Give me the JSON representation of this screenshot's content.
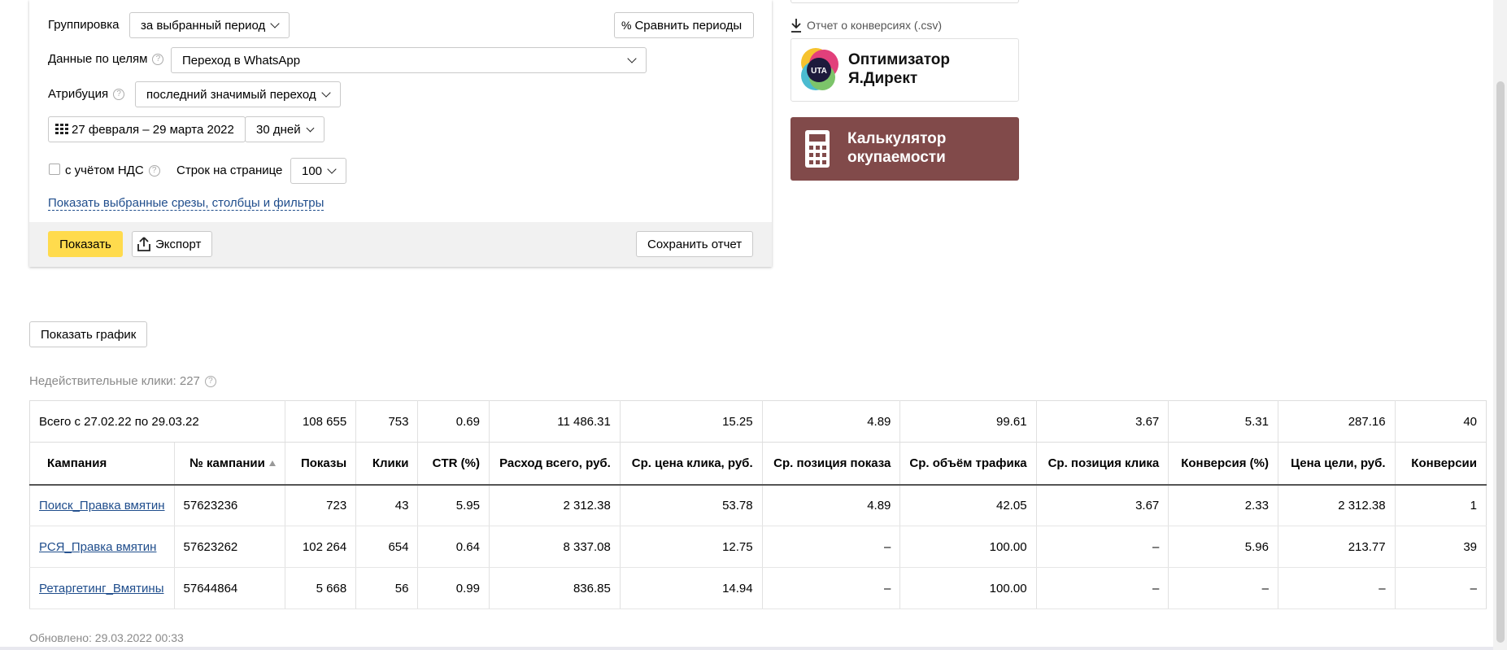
{
  "filters": {
    "grouping_label": "Группировка",
    "grouping_value": "за выбранный период",
    "compare_label": "Сравнить периоды",
    "goals_label": "Данные по целям",
    "goals_value": "Переход в WhatsApp",
    "attribution_label": "Атрибуция",
    "attribution_value": "последний значимый переход",
    "date_range": "27 февраля – 29 марта 2022",
    "period_value": "30 дней",
    "vat_label": "с учётом НДС",
    "rows_label": "Строк на странице",
    "rows_value": "100",
    "show_slices_link": "Показать выбранные срезы, столбцы и фильтры"
  },
  "actions": {
    "show_label": "Показать",
    "export_label": "Экспорт",
    "save_label": "Сохранить отчет"
  },
  "side": {
    "csv_link": "Отчет о конверсиях (.csv)",
    "optimizer_line1": "Оптимизатор",
    "optimizer_line2": "Я.Директ",
    "optimizer_logo_text": "UTA",
    "calc_line1": "Калькулятор",
    "calc_line2": "окупаемости"
  },
  "chart_button_label": "Показать график",
  "invalid_clicks": "Недействительные клики: 227",
  "updated": "Обновлено: 29.03.2022 00:33",
  "colors": {
    "accent_yellow": "#ffdb4d",
    "link_blue": "#1f4d8c",
    "calc_bg": "#814a4a"
  },
  "table": {
    "total": [
      "Всего с 27.02.22 по 29.03.22",
      "108 655",
      "753",
      "0.69",
      "11 486.31",
      "15.25",
      "4.89",
      "99.61",
      "3.67",
      "5.31",
      "287.16",
      "40"
    ],
    "headers": [
      "Кампания",
      "№ кампании",
      "Показы",
      "Клики",
      "CTR (%)",
      "Расход всего, руб.",
      "Ср. цена клика, руб.",
      "Ср. позиция показа",
      "Ср. объём трафика",
      "Ср. позиция клика",
      "Конверсия (%)",
      "Цена цели, руб.",
      "Конверсии"
    ],
    "rows": [
      [
        "Поиск_Правка вмятин",
        "57623236",
        "723",
        "43",
        "5.95",
        "2 312.38",
        "53.78",
        "4.89",
        "42.05",
        "3.67",
        "2.33",
        "2 312.38",
        "1"
      ],
      [
        "РСЯ_Правка вмятин",
        "57623262",
        "102 264",
        "654",
        "0.64",
        "8 337.08",
        "12.75",
        "–",
        "100.00",
        "–",
        "5.96",
        "213.77",
        "39"
      ],
      [
        "Ретаргетинг_Вмятины",
        "57644864",
        "5 668",
        "56",
        "0.99",
        "836.85",
        "14.94",
        "–",
        "100.00",
        "–",
        "–",
        "–",
        "–"
      ]
    ]
  }
}
